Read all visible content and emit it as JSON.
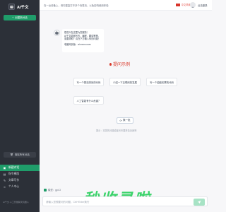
{
  "app": {
    "name": "AI千文"
  },
  "sidebar": {
    "new_chat": "创建新对话",
    "clear": "清除所有对话",
    "items": [
      {
        "label": "新建对话",
        "icon": "chat-icon",
        "active": true
      },
      {
        "label": "指令模版",
        "icon": "template-icon",
        "active": false
      },
      {
        "label": "文章写作",
        "icon": "edit-icon",
        "active": false
      },
      {
        "label": "个人中心",
        "icon": "user-icon",
        "active": false
      }
    ],
    "footer": "AI千文·人工智能聊天机器人"
  },
  "topbar": {
    "notice": "在一台设备上，请勿重复打开多个标签页，以免影响使用体验",
    "lang": "中文简体",
    "login": "点击登录"
  },
  "welcome": {
    "lines": [
      "很高兴在这里为您服务！",
      "AI千文能够写作、编程、翻译等等。",
      "需要帮助？请在下方输入你的问题！"
    ],
    "site": "电脑网页版：ai.xxxxx.com"
  },
  "examples": {
    "title": "提问示例",
    "items": [
      "写一个冒泡排序的代码",
      "介绍一下互联网的发展",
      "写一个抽取彩票的代码",
      "人工智能有什么危害？"
    ],
    "refresh": "换一批",
    "hint": "提示：将您的问题或者写作要求告诉我吧"
  },
  "model": "模型：gpt-3",
  "promo": "秒收录啦",
  "input": {
    "placeholder": "请输入您想要问的问题，Ctrl+Enter换行"
  },
  "colors": {
    "accent": "#1f9d6a",
    "sidebar": "#2c3038",
    "title_red": "#d93a2b"
  }
}
